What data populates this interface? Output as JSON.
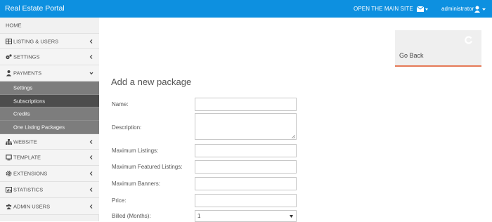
{
  "header": {
    "brand": "Real Estate Portal",
    "main_site_link": "OPEN THE MAIN SITE",
    "user_name": "administrator",
    "color": "#0d90e0"
  },
  "sidebar": {
    "home": "HOME",
    "items": [
      {
        "label": "LISTING & USERS",
        "icon": "table-icon"
      },
      {
        "label": "SETTINGS",
        "icon": "gears-icon"
      },
      {
        "label": "PAYMENTS",
        "icon": "user-icon",
        "expanded": true
      },
      {
        "label": "WEBSITE",
        "icon": "sitemap-icon"
      },
      {
        "label": "TEMPLATE",
        "icon": "monitor-icon"
      },
      {
        "label": "EXTENSIONS",
        "icon": "cog-icon"
      },
      {
        "label": "STATISTICS",
        "icon": "chart-icon"
      },
      {
        "label": "ADMIN USERS",
        "icon": "users-icon"
      }
    ],
    "payments_sub": [
      {
        "label": "Settings"
      },
      {
        "label": "Subscriptions",
        "active": true
      },
      {
        "label": "Credits"
      },
      {
        "label": "One Listing Packages"
      }
    ]
  },
  "go_back": {
    "label": "Go Back",
    "accent": "#e57956"
  },
  "form": {
    "title": "Add a new package",
    "name_label": "Name:",
    "description_label": "Description:",
    "max_listings_label": "Maximum Listings:",
    "max_featured_label": "Maximum Featured Listings:",
    "max_banners_label": "Maximum Banners:",
    "price_label": "Price:",
    "billed_label": "Billed (Months):",
    "billed_value": "1"
  }
}
